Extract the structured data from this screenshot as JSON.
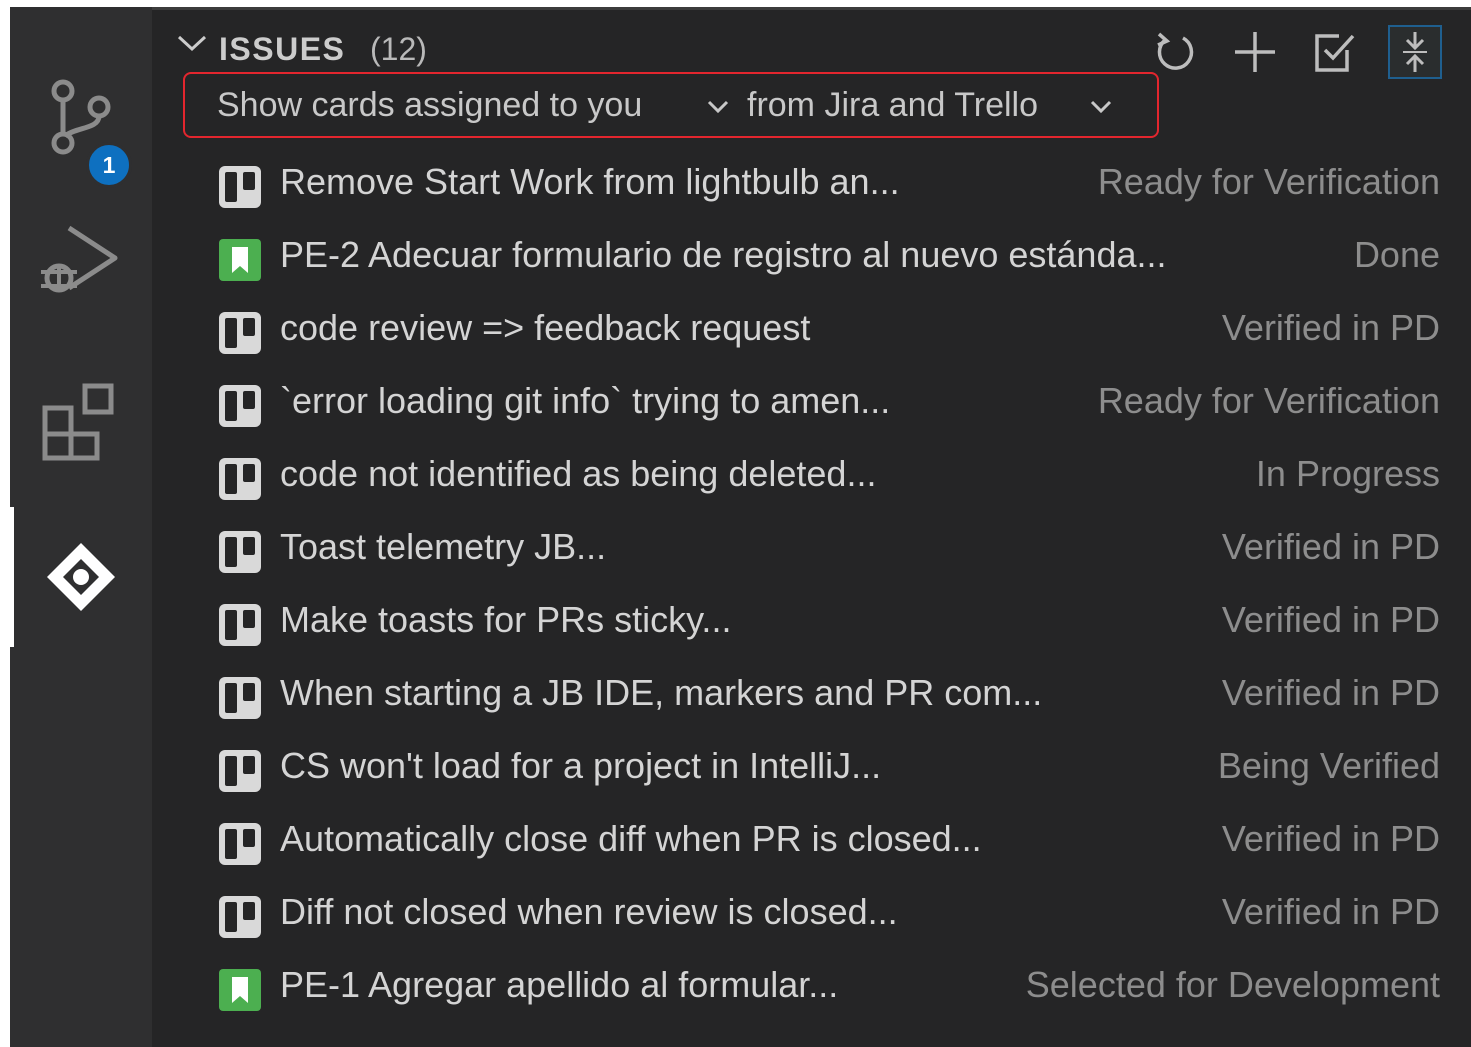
{
  "activity_bar": {
    "source_control_badge": "1"
  },
  "panel": {
    "title": "ISSUES",
    "count": "(12)",
    "actions": [
      "refresh-icon",
      "add-icon",
      "checklist-icon",
      "collapse-all-icon"
    ]
  },
  "filter": {
    "assignee_label": "Show cards assigned to you",
    "source_label": "from Jira and Trello"
  },
  "colors": {
    "accent_blue": "#0e70c0",
    "jira_green": "#4caf50",
    "highlight_red": "#e3262e"
  },
  "issues": [
    {
      "icon": "trello-icon",
      "title": "Remove Start Work from lightbulb an...",
      "status": "Ready for Verification"
    },
    {
      "icon": "jira-icon",
      "title": "PE-2 Adecuar formulario de registro al nuevo estánda...",
      "status": "Done"
    },
    {
      "icon": "trello-icon",
      "title": "code review => feedback request",
      "status": "Verified in PD"
    },
    {
      "icon": "trello-icon",
      "title": "`error loading git info` trying to amen...",
      "status": "Ready for Verification"
    },
    {
      "icon": "trello-icon",
      "title": "code not identified as being deleted...",
      "status": "In Progress"
    },
    {
      "icon": "trello-icon",
      "title": "Toast telemetry JB...",
      "status": "Verified in PD"
    },
    {
      "icon": "trello-icon",
      "title": "Make toasts for PRs sticky...",
      "status": "Verified in PD"
    },
    {
      "icon": "trello-icon",
      "title": "When starting a JB IDE, markers and PR com...",
      "status": "Verified in PD"
    },
    {
      "icon": "trello-icon",
      "title": "CS won't load for a project in IntelliJ...",
      "status": "Being Verified"
    },
    {
      "icon": "trello-icon",
      "title": "Automatically close diff when PR is closed...",
      "status": "Verified in PD"
    },
    {
      "icon": "trello-icon",
      "title": "Diff not closed when review is closed...",
      "status": "Verified in PD"
    },
    {
      "icon": "jira-icon",
      "title": "PE-1 Agregar apellido al formular...",
      "status": "Selected for Development"
    }
  ]
}
